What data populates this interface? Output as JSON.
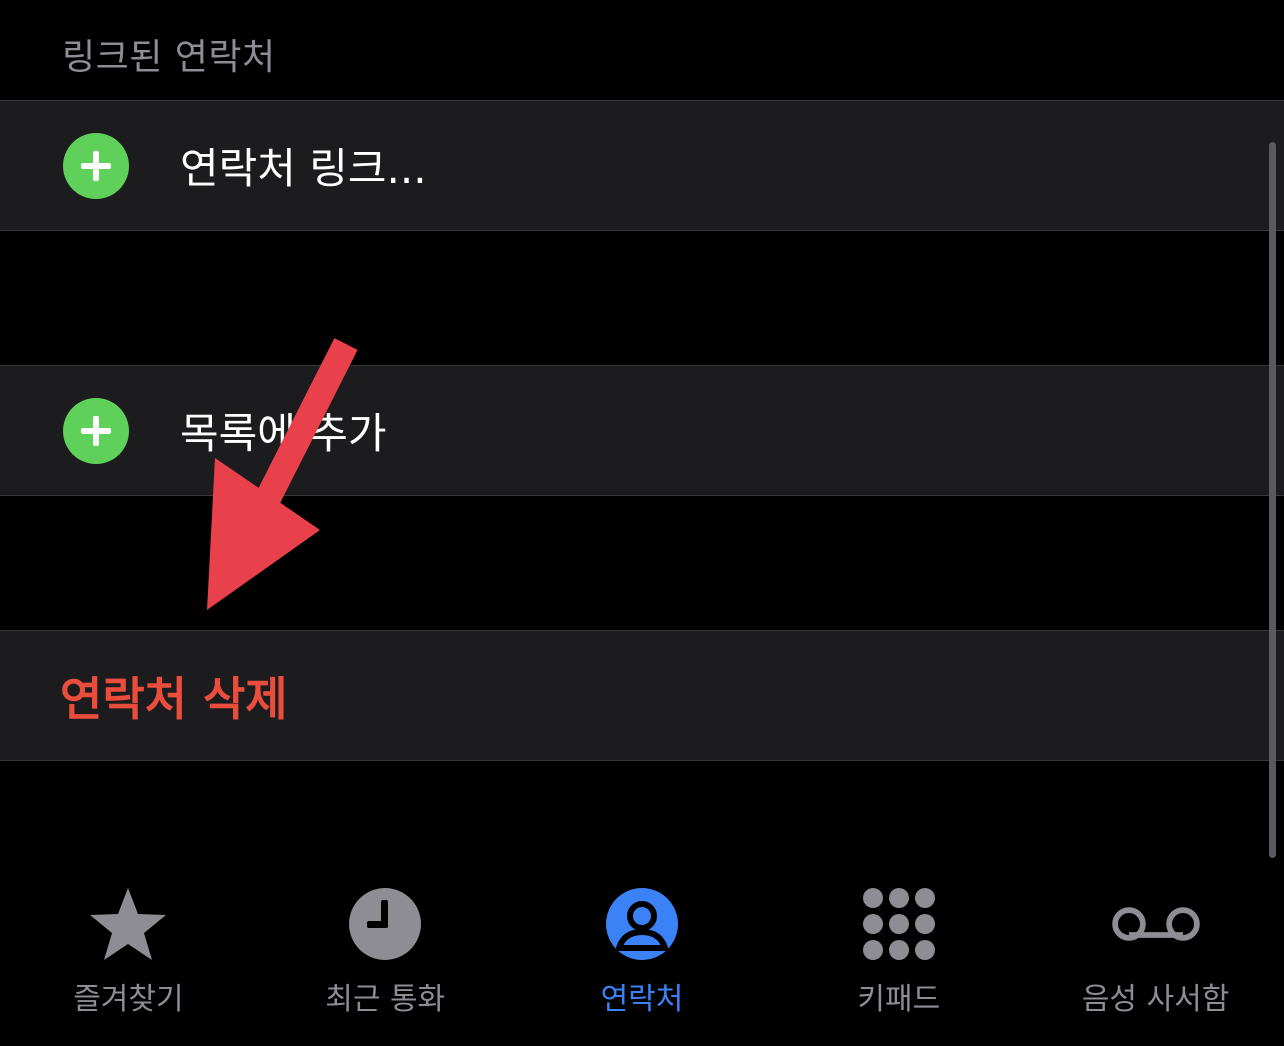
{
  "section": {
    "header": "링크된 연락처"
  },
  "rows": {
    "link_contact": "연락처 링크...",
    "add_to_list": "목록에 추가",
    "delete_contact": "연락처 삭제"
  },
  "tabbar": {
    "favorites": "즐겨찾기",
    "recents": "최근 통화",
    "contacts": "연락처",
    "keypad": "키패드",
    "voicemail": "음성 사서함"
  },
  "colors": {
    "background": "#000000",
    "cell": "#1c1c1e",
    "plus_green": "#5fd05a",
    "delete_red": "#eb4d3d",
    "active_tab_blue": "#3b82f6",
    "inactive_gray": "#8d8d93",
    "annotation_arrow": "#e8414b"
  },
  "icons": {
    "add": "plus-circle-icon",
    "favorites": "star-icon",
    "recents": "clock-icon",
    "contacts": "person-circle-icon",
    "keypad": "keypad-grid-icon",
    "voicemail": "voicemail-icon"
  }
}
